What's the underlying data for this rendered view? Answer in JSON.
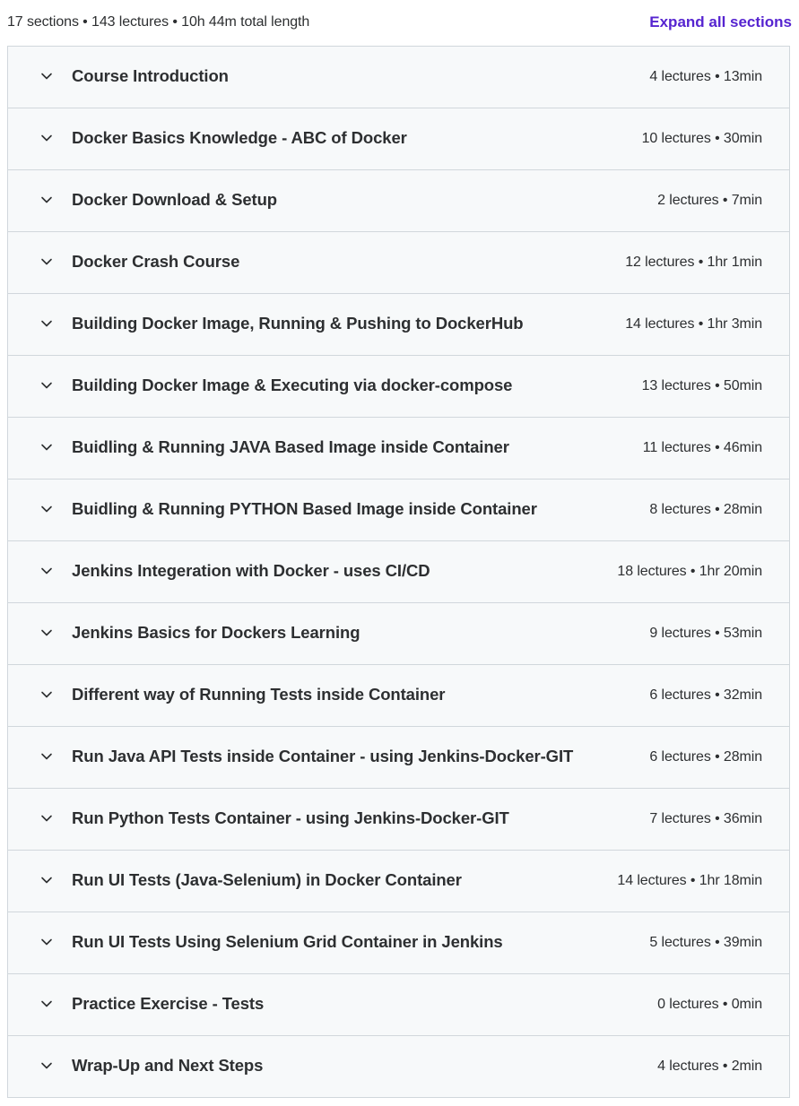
{
  "header": {
    "summary": "17 sections • 143 lectures • 10h 44m total length",
    "expand_all_label": "Expand all sections"
  },
  "accent_color": "#5624d0",
  "icons": {
    "section_toggle": "chevron-down-icon"
  },
  "sections": [
    {
      "title": "Course Introduction",
      "meta": "4 lectures • 13min"
    },
    {
      "title": "Docker Basics Knowledge - ABC of Docker",
      "meta": "10 lectures • 30min"
    },
    {
      "title": "Docker Download & Setup",
      "meta": "2 lectures • 7min"
    },
    {
      "title": "Docker Crash Course",
      "meta": "12 lectures • 1hr 1min"
    },
    {
      "title": "Building Docker Image, Running & Pushing to DockerHub",
      "meta": "14 lectures • 1hr 3min"
    },
    {
      "title": "Building Docker Image & Executing via docker-compose",
      "meta": "13 lectures • 50min"
    },
    {
      "title": "Buidling & Running JAVA Based Image inside Container",
      "meta": "11 lectures • 46min"
    },
    {
      "title": "Buidling & Running PYTHON Based Image inside Container",
      "meta": "8 lectures • 28min"
    },
    {
      "title": "Jenkins Integeration with Docker - uses CI/CD",
      "meta": "18 lectures • 1hr 20min"
    },
    {
      "title": "Jenkins Basics for Dockers Learning",
      "meta": "9 lectures • 53min"
    },
    {
      "title": "Different way of Running Tests inside Container",
      "meta": "6 lectures • 32min"
    },
    {
      "title": "Run Java API Tests inside Container - using Jenkins-Docker-GIT",
      "meta": "6 lectures • 28min"
    },
    {
      "title": "Run Python Tests Container - using Jenkins-Docker-GIT",
      "meta": "7 lectures • 36min"
    },
    {
      "title": "Run UI Tests (Java-Selenium) in Docker Container",
      "meta": "14 lectures • 1hr 18min"
    },
    {
      "title": "Run UI Tests Using Selenium Grid Container in Jenkins",
      "meta": "5 lectures • 39min"
    },
    {
      "title": "Practice Exercise - Tests",
      "meta": "0 lectures • 0min"
    },
    {
      "title": "Wrap-Up and Next Steps",
      "meta": "4 lectures • 2min"
    }
  ]
}
